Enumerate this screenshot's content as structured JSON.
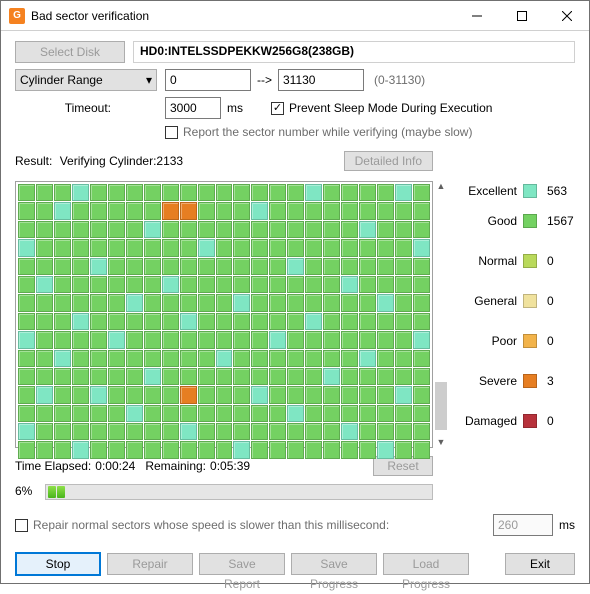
{
  "title": "Bad sector verification",
  "toolbar": {
    "select_disk": "Select Disk",
    "disk_name": "HD0:INTELSSDPEKKW256G8(238GB)"
  },
  "range": {
    "label": "Cylinder Range",
    "from": "0",
    "to": "31130",
    "hint": "(0-31130)",
    "arrow": "-->"
  },
  "timeout": {
    "label": "Timeout:",
    "value": "3000",
    "unit": "ms"
  },
  "options": {
    "prevent_sleep": "Prevent Sleep Mode During Execution",
    "report_sector": "Report the sector number while verifying (maybe slow)"
  },
  "result": {
    "prefix": "Result:",
    "status": "Verifying Cylinder:2133",
    "detailed_info": "Detailed Info"
  },
  "legend": {
    "excellent": {
      "label": "Excellent",
      "count": "563",
      "color": "#7fe6c3"
    },
    "good": {
      "label": "Good",
      "count": "1567",
      "color": "#74d162"
    },
    "normal": {
      "label": "Normal",
      "count": "0",
      "color": "#b9d95b"
    },
    "general": {
      "label": "General",
      "count": "0",
      "color": "#f0e29e"
    },
    "poor": {
      "label": "Poor",
      "count": "0",
      "color": "#f2b34a"
    },
    "severe": {
      "label": "Severe",
      "count": "3",
      "color": "#e67e22"
    },
    "damaged": {
      "label": "Damaged",
      "count": "0",
      "color": "#b7323b"
    }
  },
  "time": {
    "elapsed_label": "Time Elapsed:",
    "elapsed": "0:00:24",
    "remaining_label": "Remaining:",
    "remaining": "0:05:39",
    "reset": "Reset"
  },
  "progress": {
    "percent_label": "6%",
    "percent": 6
  },
  "repair_ms": {
    "label": "Repair normal sectors whose speed is slower than this millisecond:",
    "value": "260",
    "unit": "ms"
  },
  "buttons": {
    "stop": "Stop",
    "repair": "Repair",
    "save_report": "Save Report",
    "save_progress": "Save Progress",
    "load_progress": "Load Progress",
    "exit": "Exit"
  },
  "grid": {
    "cols": 23,
    "rows": 15,
    "severe_cells": [
      [
        1,
        8
      ],
      [
        1,
        9
      ],
      [
        11,
        9
      ]
    ],
    "excellent_cells": [
      [
        0,
        3
      ],
      [
        0,
        16
      ],
      [
        0,
        21
      ],
      [
        1,
        2
      ],
      [
        1,
        13
      ],
      [
        2,
        7
      ],
      [
        2,
        19
      ],
      [
        3,
        0
      ],
      [
        3,
        10
      ],
      [
        3,
        22
      ],
      [
        4,
        4
      ],
      [
        4,
        15
      ],
      [
        5,
        1
      ],
      [
        5,
        8
      ],
      [
        5,
        18
      ],
      [
        6,
        6
      ],
      [
        6,
        12
      ],
      [
        6,
        20
      ],
      [
        7,
        3
      ],
      [
        7,
        9
      ],
      [
        7,
        16
      ],
      [
        8,
        0
      ],
      [
        8,
        5
      ],
      [
        8,
        14
      ],
      [
        8,
        22
      ],
      [
        9,
        2
      ],
      [
        9,
        11
      ],
      [
        9,
        19
      ],
      [
        10,
        7
      ],
      [
        10,
        17
      ],
      [
        11,
        1
      ],
      [
        11,
        4
      ],
      [
        11,
        13
      ],
      [
        11,
        21
      ],
      [
        12,
        6
      ],
      [
        12,
        15
      ],
      [
        13,
        0
      ],
      [
        13,
        9
      ],
      [
        13,
        18
      ],
      [
        14,
        3
      ],
      [
        14,
        12
      ],
      [
        14,
        20
      ]
    ]
  }
}
